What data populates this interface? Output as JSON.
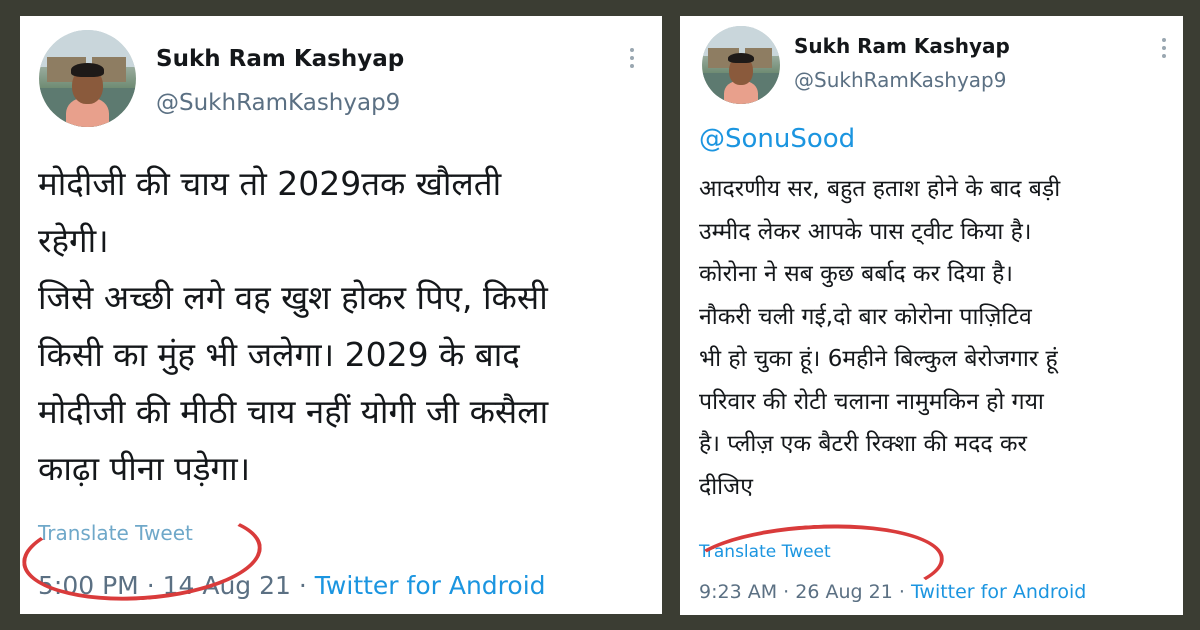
{
  "colors": {
    "background": "#3b3d33",
    "card": "#ffffff",
    "link": "#1b95e0",
    "secondary_text": "#5b7083",
    "annotation": "#d93b3b"
  },
  "tweets": [
    {
      "author_name": "Sukh Ram Kashyap",
      "author_handle": "@SukhRamKashyap9",
      "avatar_icon": "profile-photo",
      "menu_icon": "vertical-ellipsis-icon",
      "mention": "",
      "text_lines": [
        "मोदीजी की चाय तो 2029तक खौलती",
        "रहेगी।",
        "जिसे अच्छी लगे वह खुश होकर पिए, किसी",
        "किसी का मुंह भी जलेगा। 2029 के बाद",
        "मोदीजी की मीठी चाय नहीं योगी जी कसैला",
        "काढ़ा पीना पड़ेगा।"
      ],
      "translate_label": "Translate Tweet",
      "time": "5:00 PM",
      "separator": "·",
      "date": "14 Aug 21",
      "source": "Twitter for Android"
    },
    {
      "author_name": "Sukh Ram Kashyap",
      "author_handle": "@SukhRamKashyap9",
      "avatar_icon": "profile-photo",
      "menu_icon": "vertical-ellipsis-icon",
      "mention": "@SonuSood",
      "text_lines": [
        "आदरणीय सर, बहुत हताश होने के बाद बड़ी",
        "उम्मीद लेकर आपके पास ट्वीट किया है।",
        "कोरोना ने सब कुछ बर्बाद कर दिया है।",
        "नौकरी चली गई,दो बार कोरोना पाज़िटिव",
        "भी हो चुका हूं। 6महीने बिल्कुल बेरोजगार हूं",
        "परिवार की रोटी चलाना नामुमकिन हो गया",
        "है। प्लीज़ एक बैटरी रिक्शा की मदद कर",
        "दीजिए"
      ],
      "translate_label": "Translate Tweet",
      "time": "9:23 AM",
      "separator": "·",
      "date": "26 Aug 21",
      "source": "Twitter for Android"
    }
  ]
}
